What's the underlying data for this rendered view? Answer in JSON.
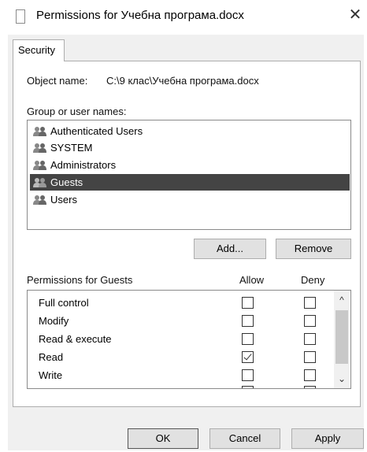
{
  "window": {
    "title": "Permissions for Учебна програма.docx",
    "close_glyph": "✕"
  },
  "tab": {
    "label": "Security"
  },
  "object": {
    "label": "Object name:",
    "value": "C:\\9 клас\\Учебна програма.docx"
  },
  "groups": {
    "label": "Group or user names:",
    "items": [
      {
        "name": "Authenticated Users",
        "icon": "users-group-icon",
        "selected": false
      },
      {
        "name": "SYSTEM",
        "icon": "users-group-icon",
        "selected": false
      },
      {
        "name": "Administrators",
        "icon": "users-group-icon",
        "selected": false
      },
      {
        "name": "Guests",
        "icon": "users-group-icon",
        "selected": true
      },
      {
        "name": "Users",
        "icon": "users-group-icon",
        "selected": false
      }
    ]
  },
  "buttons": {
    "add": "Add...",
    "remove": "Remove",
    "ok": "OK",
    "cancel": "Cancel",
    "apply": "Apply"
  },
  "permissions": {
    "label": "Permissions for Guests",
    "allow_header": "Allow",
    "deny_header": "Deny",
    "rows": [
      {
        "name": "Full control",
        "allow": false,
        "deny": false
      },
      {
        "name": "Modify",
        "allow": false,
        "deny": false
      },
      {
        "name": "Read & execute",
        "allow": false,
        "deny": false
      },
      {
        "name": "Read",
        "allow": true,
        "deny": false
      },
      {
        "name": "Write",
        "allow": false,
        "deny": false
      }
    ],
    "scroll_up_glyph": "^",
    "scroll_down_glyph": "⌄"
  },
  "colors": {
    "selection": "#444444",
    "dialog_bg": "#f0f0f0",
    "button_bg": "#e1e1e1"
  }
}
